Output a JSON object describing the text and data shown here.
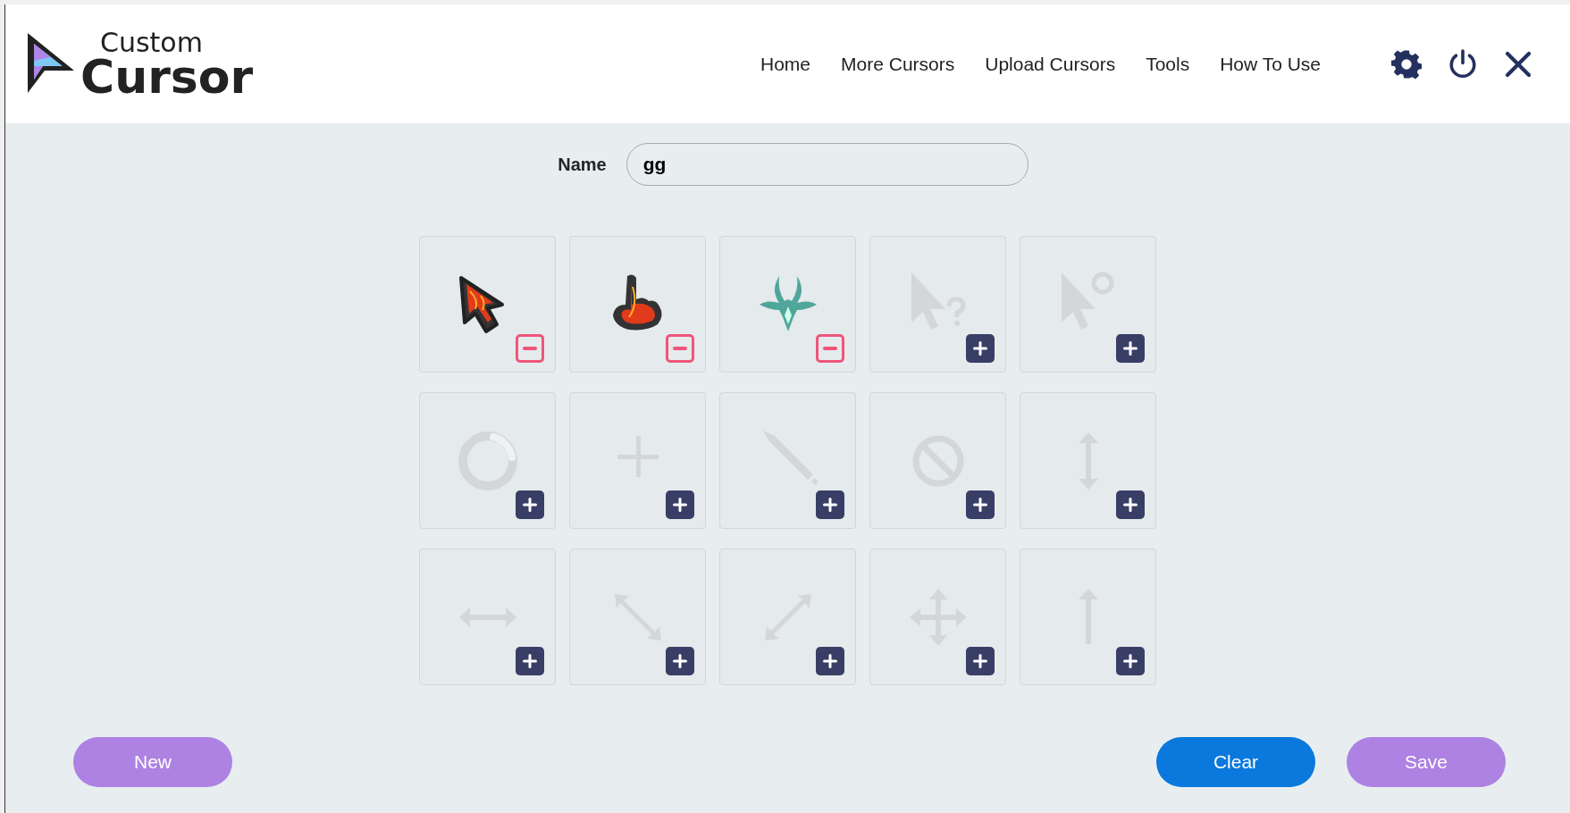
{
  "logo": {
    "top": "Custom",
    "bottom": "Cursor"
  },
  "nav": [
    "Home",
    "More Cursors",
    "Upload Cursors",
    "Tools",
    "How To Use"
  ],
  "name_field": {
    "label": "Name",
    "value": "gg"
  },
  "slots": [
    {
      "kind": "normal",
      "filled": true
    },
    {
      "kind": "link",
      "filled": true
    },
    {
      "kind": "text",
      "filled": true
    },
    {
      "kind": "help",
      "filled": false
    },
    {
      "kind": "working",
      "filled": false
    },
    {
      "kind": "busy",
      "filled": false
    },
    {
      "kind": "precision",
      "filled": false
    },
    {
      "kind": "handwriting",
      "filled": false
    },
    {
      "kind": "unavailable",
      "filled": false
    },
    {
      "kind": "vertical",
      "filled": false
    },
    {
      "kind": "horizontal",
      "filled": false
    },
    {
      "kind": "diagonal1",
      "filled": false
    },
    {
      "kind": "diagonal2",
      "filled": false
    },
    {
      "kind": "move",
      "filled": false
    },
    {
      "kind": "alternate",
      "filled": false
    }
  ],
  "buttons": {
    "new": "New",
    "clear": "Clear",
    "save": "Save"
  }
}
